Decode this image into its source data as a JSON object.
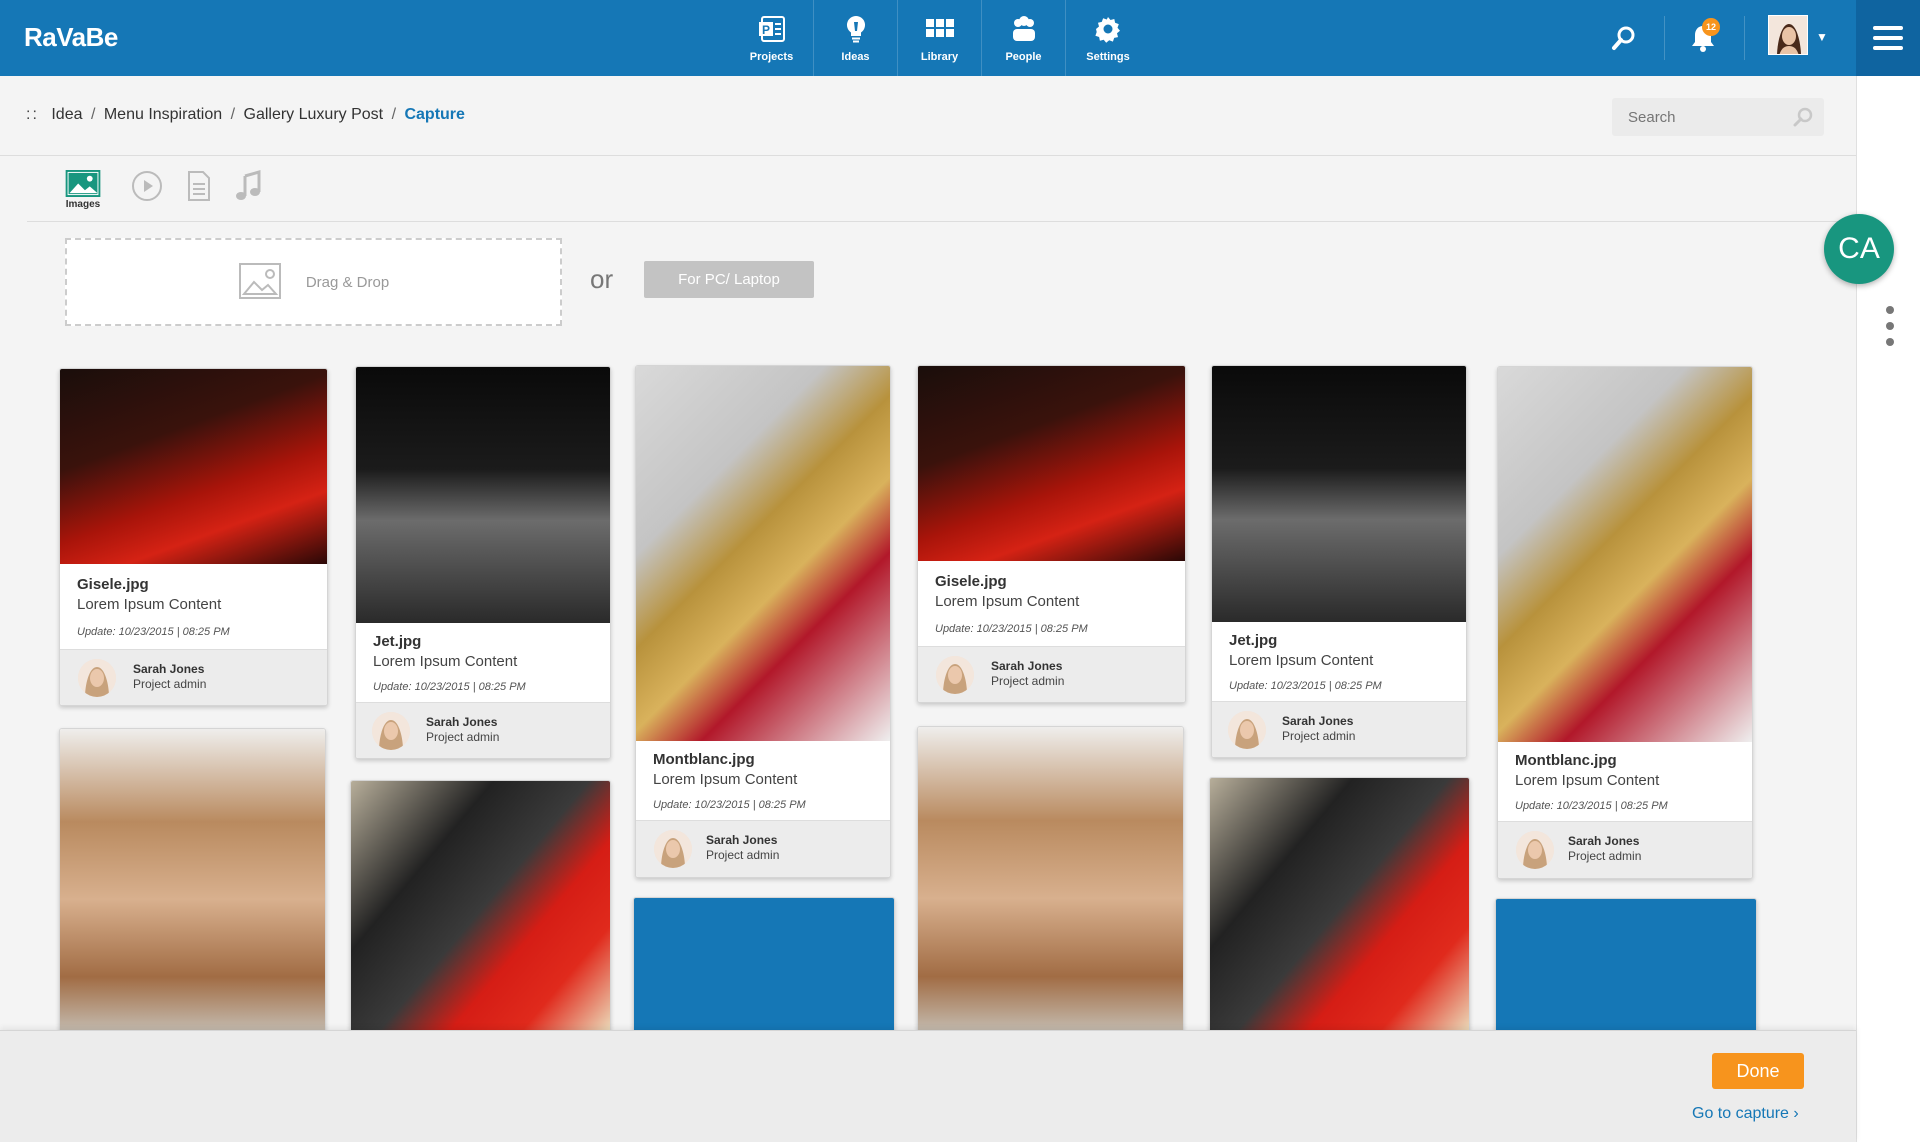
{
  "app": {
    "logo": "RaVaBe"
  },
  "nav": [
    {
      "label": "Projects",
      "icon": "projects-icon"
    },
    {
      "label": "Ideas",
      "icon": "lightbulb-icon"
    },
    {
      "label": "Library",
      "icon": "library-grid-icon"
    },
    {
      "label": "People",
      "icon": "people-icon"
    },
    {
      "label": "Settings",
      "icon": "gear-icon"
    }
  ],
  "notifications": {
    "count": "12"
  },
  "breadcrumb": {
    "prefix": "::",
    "items": [
      "Idea",
      "Menu Inspiration",
      "Gallery Luxury Post"
    ],
    "current": "Capture"
  },
  "search": {
    "placeholder": "Search"
  },
  "media_tabs": {
    "active_label": "Images"
  },
  "upload": {
    "dropzone_label": "Drag & Drop",
    "or": "or",
    "pc_button": "For PC/ Laptop"
  },
  "collaborator": {
    "initials": "CA",
    "color": "#18967f"
  },
  "colors": {
    "brand": "#1577b6",
    "accent": "#f7941d"
  },
  "cards": [
    {
      "title": "Gisele.jpg",
      "content": "Lorem Ipsum Content",
      "update": "Update: 10/23/2015 | 08:25 PM",
      "author": "Sarah Jones",
      "role": "Project admin"
    },
    {
      "title": "Jet.jpg",
      "content": "Lorem Ipsum Content",
      "update": "Update: 10/23/2015 | 08:25 PM",
      "author": "Sarah Jones",
      "role": "Project admin"
    },
    {
      "title": "Montblanc.jpg",
      "content": "Lorem Ipsum Content",
      "update": "Update: 10/23/2015 | 08:25 PM",
      "author": "Sarah Jones",
      "role": "Project admin"
    },
    {
      "title": "Gisele.jpg",
      "content": "Lorem Ipsum Content",
      "update": "Update: 10/23/2015 | 08:25 PM",
      "author": "Sarah Jones",
      "role": "Project admin"
    },
    {
      "title": "Jet.jpg",
      "content": "Lorem Ipsum Content",
      "update": "Update: 10/23/2015 | 08:25 PM",
      "author": "Sarah Jones",
      "role": "Project admin"
    },
    {
      "title": "Montblanc.jpg",
      "content": "Lorem Ipsum Content",
      "update": "Update: 10/23/2015 | 08:25 PM",
      "author": "Sarah Jones",
      "role": "Project admin"
    }
  ],
  "footer": {
    "done": "Done",
    "goto": "Go to capture ›"
  }
}
